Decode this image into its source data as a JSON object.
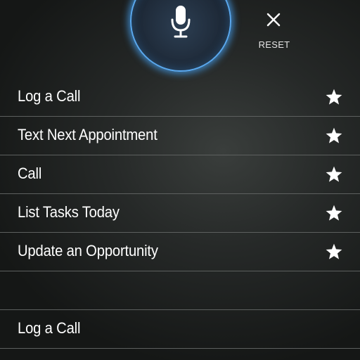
{
  "header": {
    "mic_icon": "microphone-icon",
    "reset_icon": "close-icon",
    "reset_label": "RESET",
    "accent_color": "#5aa8ee"
  },
  "commands": [
    {
      "label": "Log a Call",
      "icon": "star-icon"
    },
    {
      "label": "Text Next Appointment",
      "icon": "star-icon"
    },
    {
      "label": "Call",
      "icon": "star-icon"
    },
    {
      "label": "List Tasks Today",
      "icon": "star-icon"
    },
    {
      "label": "Update an Opportunity",
      "icon": "star-icon"
    }
  ],
  "recent": [
    {
      "label": "Log a Call"
    }
  ]
}
